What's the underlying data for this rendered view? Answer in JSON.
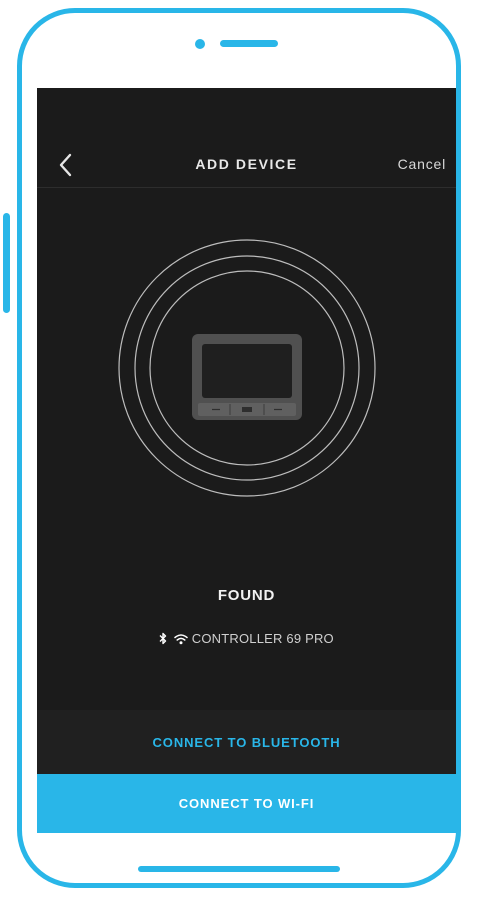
{
  "header": {
    "title": "ADD DEVICE",
    "back_icon": "chevron-left-icon",
    "cancel_label": "Cancel"
  },
  "status": {
    "found_label": "FOUND",
    "device_name": "CONTROLLER 69 PRO",
    "device_icons": [
      "bluetooth-icon",
      "wifi-icon"
    ]
  },
  "actions": {
    "bluetooth_label": "CONNECT TO BLUETOOTH",
    "wifi_label": "CONNECT TO WI-FI"
  },
  "colors": {
    "accent": "#29b6e8",
    "screen_background": "#1b1b1b",
    "phone_frame": "#29b6e8"
  }
}
